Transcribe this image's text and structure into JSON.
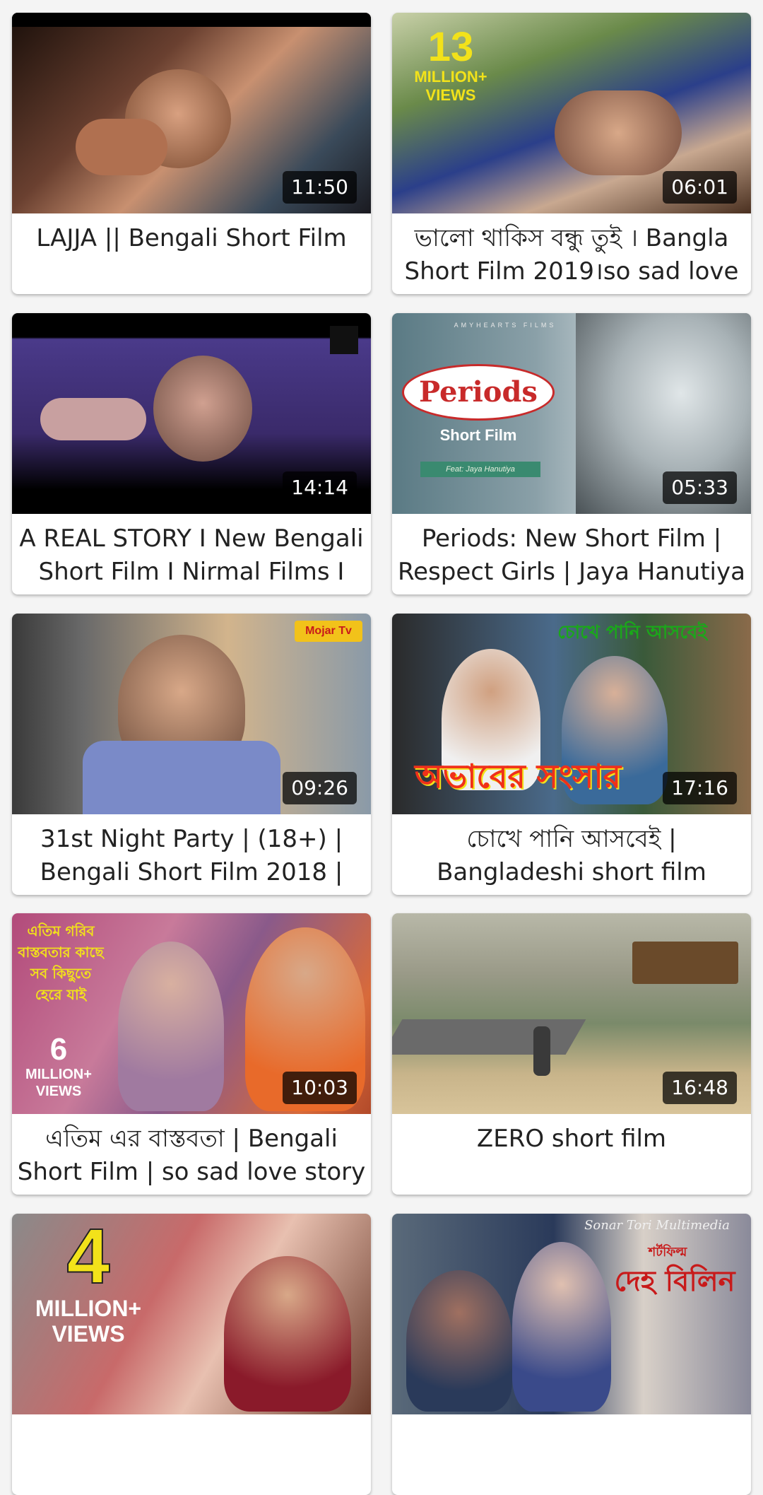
{
  "videos": [
    {
      "title": "LAJJA || Bengali Short Film",
      "duration": "11:50",
      "thumb_colors": [
        "#2c1a12",
        "#8a5a3c",
        "#3a4a5a"
      ],
      "overlay": null
    },
    {
      "title": "ভালো থাকিস বন্ধু তুই । Bangla Short Film 2019।so sad love",
      "duration": "06:01",
      "thumb_colors": [
        "#3b6a2e",
        "#2b3f8a",
        "#c8a890"
      ],
      "overlay": {
        "big": "13",
        "line1": "MILLION+",
        "line2": "VIEWS"
      }
    },
    {
      "title": "A REAL STORY I New Bengali Short Film I Nirmal Films I",
      "duration": "14:14",
      "thumb_colors": [
        "#0a0a0a",
        "#3a2a6a",
        "#b08a80"
      ],
      "overlay": null
    },
    {
      "title": "Periods: New Short Film | Respect Girls | Jaya Hanutiya",
      "duration": "05:33",
      "thumb_colors": [
        "#6f8a94",
        "#c9d2d6",
        "#5a6468"
      ],
      "overlay": {
        "badge": "Periods",
        "sub": "Short Film",
        "feat": "Feat: Jaya Hanutiya",
        "brand": "AMYHEARTS FILMS"
      }
    },
    {
      "title": "31st Night Party | (18+) | Bengali Short Film 2018 |",
      "duration": "09:26",
      "thumb_colors": [
        "#6a5a3a",
        "#7a8aa8",
        "#d2b48c"
      ],
      "overlay": {
        "logo": "Mojar Tv"
      }
    },
    {
      "title": "চোখে পানি আসবেই | Bangladeshi short film",
      "duration": "17:16",
      "thumb_colors": [
        "#2a2a2a",
        "#4a6a8a",
        "#c03a2a"
      ],
      "overlay": {
        "top": "চোখে পানি আসবেই",
        "bottom": "অভাবের সংসার"
      }
    },
    {
      "title": "এতিম এর বাস্তবতা | Bengali Short Film | so sad love story",
      "duration": "10:03",
      "thumb_colors": [
        "#b24a7a",
        "#d86a3a",
        "#8a5a8a"
      ],
      "overlay": {
        "big": "6",
        "line1": "MILLION+",
        "line2": "VIEWS",
        "bengali": "এতিম গরিব বাস্তবতার কাছে সব কিছুতে হেরে যাই"
      }
    },
    {
      "title": "ZERO short film",
      "duration": "16:48",
      "thumb_colors": [
        "#9a9a88",
        "#c8b48a",
        "#7a8a6a"
      ],
      "overlay": null
    },
    {
      "title": "",
      "duration": "",
      "thumb_colors": [
        "#c86a6a",
        "#6a3a2a",
        "#e8c0b0"
      ],
      "overlay": {
        "big": "4",
        "line1": "MILLION+",
        "line2": "VIEWS"
      }
    },
    {
      "title": "",
      "duration": "",
      "thumb_colors": [
        "#5a6a7a",
        "#2a3a5a",
        "#d8d0c8"
      ],
      "overlay": {
        "brand": "Sonar Tori Multimedia",
        "kicker": "শর্টফিল্ম",
        "name": "দেহ বিলিন"
      }
    }
  ]
}
